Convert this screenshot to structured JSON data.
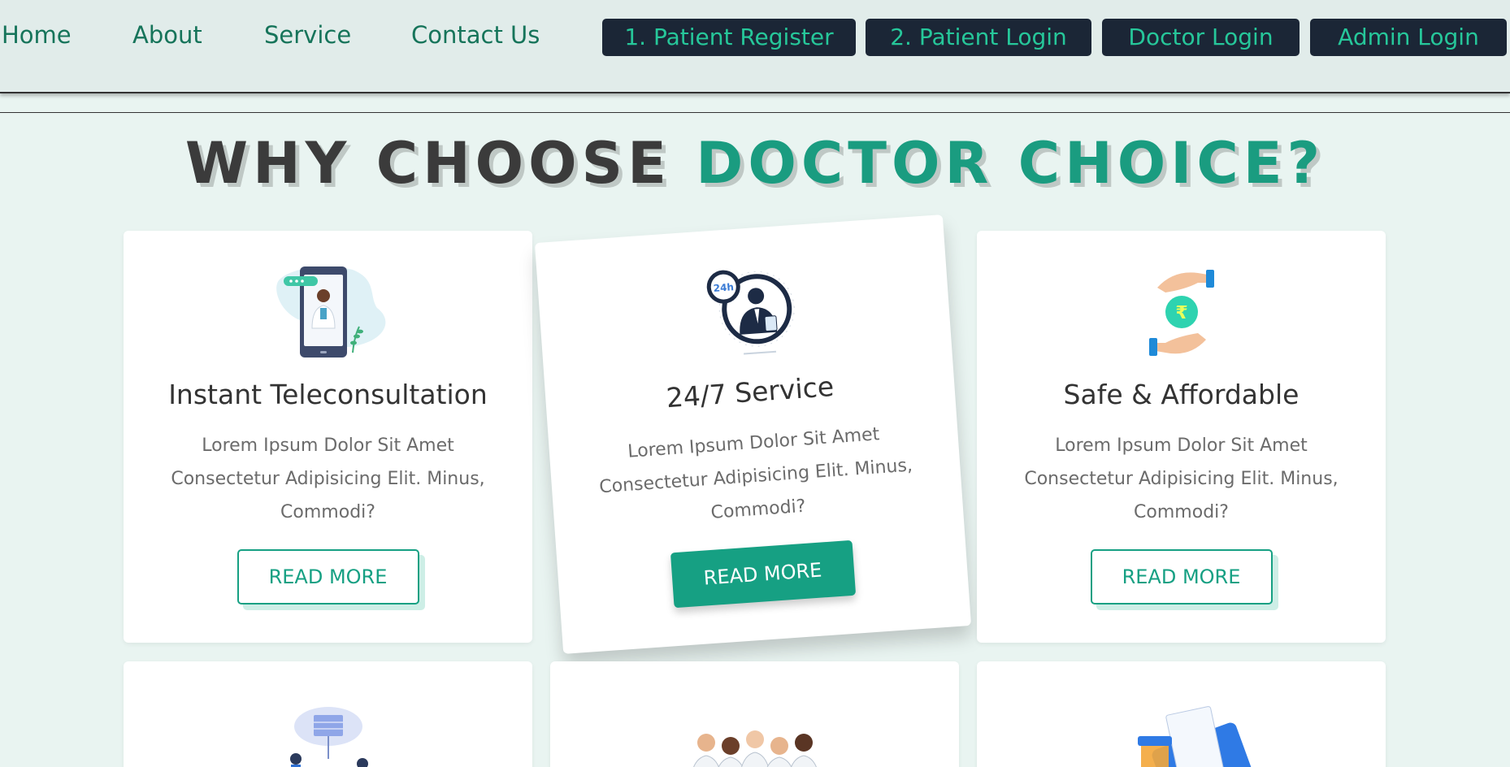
{
  "nav": {
    "links": [
      "Home",
      "About",
      "Service",
      "Contact Us"
    ],
    "buttons": [
      "1. Patient Register",
      "2. Patient Login",
      "Doctor Login",
      "Admin Login"
    ]
  },
  "headline": {
    "part1": "WHY CHOOSE ",
    "part2": "DOCTOR CHOICE?"
  },
  "cards": [
    {
      "title": "Instant Teleconsultation",
      "text": "Lorem Ipsum Dolor Sit Amet Consectetur Adipisicing Elit. Minus, Commodi?",
      "button": "READ MORE",
      "icon": "mobile-doctor-icon"
    },
    {
      "title": "24/7 Service",
      "text": "Lorem Ipsum Dolor Sit Amet Consectetur Adipisicing Elit. Minus, Commodi?",
      "button": "READ MORE",
      "icon": "24h-doctor-icon",
      "badge": "24h"
    },
    {
      "title": "Safe & Affordable",
      "text": "Lorem Ipsum Dolor Sit Amet Consectetur Adipisicing Elit. Minus, Commodi?",
      "button": "READ MORE",
      "icon": "rupee-hands-icon",
      "symbol": "₹"
    }
  ],
  "bottom_cards": [
    {
      "icon": "cloud-network-icon"
    },
    {
      "icon": "doctors-group-icon"
    },
    {
      "icon": "prescription-medicine-icon"
    }
  ],
  "colors": {
    "accent": "#1a9c80",
    "nav_button_bg": "#1b2636",
    "nav_button_text": "#26c79a",
    "nav_link": "#16745a",
    "page_bg": "#e9f4f1"
  }
}
